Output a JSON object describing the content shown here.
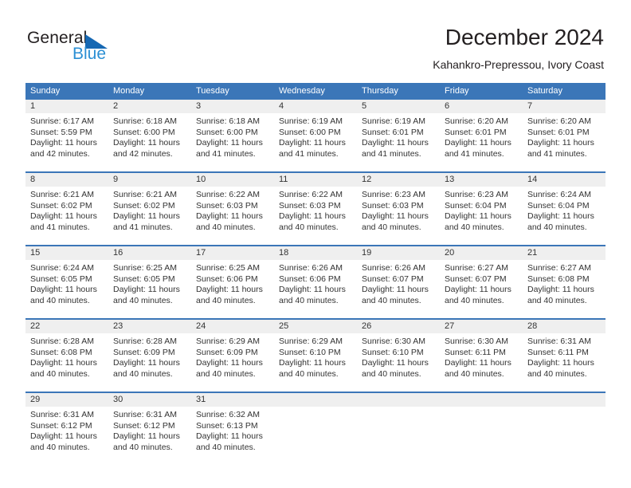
{
  "brand": {
    "word_one": "General",
    "word_two": "Blue",
    "triangle_icon": "triangle-icon",
    "accent_blue": "#1668b3",
    "light_blue": "#2b8fd4"
  },
  "header": {
    "title": "December 2024",
    "subtitle": "Kahankro-Prepressou, Ivory Coast"
  },
  "theme": {
    "header_blue": "#3b76b8",
    "day_band_gray": "#efefef",
    "text": "#333333"
  },
  "calendar": {
    "weekdays": [
      "Sunday",
      "Monday",
      "Tuesday",
      "Wednesday",
      "Thursday",
      "Friday",
      "Saturday"
    ],
    "weeks": [
      [
        {
          "day": "1",
          "sunrise": "Sunrise: 6:17 AM",
          "sunset": "Sunset: 5:59 PM",
          "daylight_1": "Daylight: 11 hours",
          "daylight_2": "and 42 minutes."
        },
        {
          "day": "2",
          "sunrise": "Sunrise: 6:18 AM",
          "sunset": "Sunset: 6:00 PM",
          "daylight_1": "Daylight: 11 hours",
          "daylight_2": "and 42 minutes."
        },
        {
          "day": "3",
          "sunrise": "Sunrise: 6:18 AM",
          "sunset": "Sunset: 6:00 PM",
          "daylight_1": "Daylight: 11 hours",
          "daylight_2": "and 41 minutes."
        },
        {
          "day": "4",
          "sunrise": "Sunrise: 6:19 AM",
          "sunset": "Sunset: 6:00 PM",
          "daylight_1": "Daylight: 11 hours",
          "daylight_2": "and 41 minutes."
        },
        {
          "day": "5",
          "sunrise": "Sunrise: 6:19 AM",
          "sunset": "Sunset: 6:01 PM",
          "daylight_1": "Daylight: 11 hours",
          "daylight_2": "and 41 minutes."
        },
        {
          "day": "6",
          "sunrise": "Sunrise: 6:20 AM",
          "sunset": "Sunset: 6:01 PM",
          "daylight_1": "Daylight: 11 hours",
          "daylight_2": "and 41 minutes."
        },
        {
          "day": "7",
          "sunrise": "Sunrise: 6:20 AM",
          "sunset": "Sunset: 6:01 PM",
          "daylight_1": "Daylight: 11 hours",
          "daylight_2": "and 41 minutes."
        }
      ],
      [
        {
          "day": "8",
          "sunrise": "Sunrise: 6:21 AM",
          "sunset": "Sunset: 6:02 PM",
          "daylight_1": "Daylight: 11 hours",
          "daylight_2": "and 41 minutes."
        },
        {
          "day": "9",
          "sunrise": "Sunrise: 6:21 AM",
          "sunset": "Sunset: 6:02 PM",
          "daylight_1": "Daylight: 11 hours",
          "daylight_2": "and 41 minutes."
        },
        {
          "day": "10",
          "sunrise": "Sunrise: 6:22 AM",
          "sunset": "Sunset: 6:03 PM",
          "daylight_1": "Daylight: 11 hours",
          "daylight_2": "and 40 minutes."
        },
        {
          "day": "11",
          "sunrise": "Sunrise: 6:22 AM",
          "sunset": "Sunset: 6:03 PM",
          "daylight_1": "Daylight: 11 hours",
          "daylight_2": "and 40 minutes."
        },
        {
          "day": "12",
          "sunrise": "Sunrise: 6:23 AM",
          "sunset": "Sunset: 6:03 PM",
          "daylight_1": "Daylight: 11 hours",
          "daylight_2": "and 40 minutes."
        },
        {
          "day": "13",
          "sunrise": "Sunrise: 6:23 AM",
          "sunset": "Sunset: 6:04 PM",
          "daylight_1": "Daylight: 11 hours",
          "daylight_2": "and 40 minutes."
        },
        {
          "day": "14",
          "sunrise": "Sunrise: 6:24 AM",
          "sunset": "Sunset: 6:04 PM",
          "daylight_1": "Daylight: 11 hours",
          "daylight_2": "and 40 minutes."
        }
      ],
      [
        {
          "day": "15",
          "sunrise": "Sunrise: 6:24 AM",
          "sunset": "Sunset: 6:05 PM",
          "daylight_1": "Daylight: 11 hours",
          "daylight_2": "and 40 minutes."
        },
        {
          "day": "16",
          "sunrise": "Sunrise: 6:25 AM",
          "sunset": "Sunset: 6:05 PM",
          "daylight_1": "Daylight: 11 hours",
          "daylight_2": "and 40 minutes."
        },
        {
          "day": "17",
          "sunrise": "Sunrise: 6:25 AM",
          "sunset": "Sunset: 6:06 PM",
          "daylight_1": "Daylight: 11 hours",
          "daylight_2": "and 40 minutes."
        },
        {
          "day": "18",
          "sunrise": "Sunrise: 6:26 AM",
          "sunset": "Sunset: 6:06 PM",
          "daylight_1": "Daylight: 11 hours",
          "daylight_2": "and 40 minutes."
        },
        {
          "day": "19",
          "sunrise": "Sunrise: 6:26 AM",
          "sunset": "Sunset: 6:07 PM",
          "daylight_1": "Daylight: 11 hours",
          "daylight_2": "and 40 minutes."
        },
        {
          "day": "20",
          "sunrise": "Sunrise: 6:27 AM",
          "sunset": "Sunset: 6:07 PM",
          "daylight_1": "Daylight: 11 hours",
          "daylight_2": "and 40 minutes."
        },
        {
          "day": "21",
          "sunrise": "Sunrise: 6:27 AM",
          "sunset": "Sunset: 6:08 PM",
          "daylight_1": "Daylight: 11 hours",
          "daylight_2": "and 40 minutes."
        }
      ],
      [
        {
          "day": "22",
          "sunrise": "Sunrise: 6:28 AM",
          "sunset": "Sunset: 6:08 PM",
          "daylight_1": "Daylight: 11 hours",
          "daylight_2": "and 40 minutes."
        },
        {
          "day": "23",
          "sunrise": "Sunrise: 6:28 AM",
          "sunset": "Sunset: 6:09 PM",
          "daylight_1": "Daylight: 11 hours",
          "daylight_2": "and 40 minutes."
        },
        {
          "day": "24",
          "sunrise": "Sunrise: 6:29 AM",
          "sunset": "Sunset: 6:09 PM",
          "daylight_1": "Daylight: 11 hours",
          "daylight_2": "and 40 minutes."
        },
        {
          "day": "25",
          "sunrise": "Sunrise: 6:29 AM",
          "sunset": "Sunset: 6:10 PM",
          "daylight_1": "Daylight: 11 hours",
          "daylight_2": "and 40 minutes."
        },
        {
          "day": "26",
          "sunrise": "Sunrise: 6:30 AM",
          "sunset": "Sunset: 6:10 PM",
          "daylight_1": "Daylight: 11 hours",
          "daylight_2": "and 40 minutes."
        },
        {
          "day": "27",
          "sunrise": "Sunrise: 6:30 AM",
          "sunset": "Sunset: 6:11 PM",
          "daylight_1": "Daylight: 11 hours",
          "daylight_2": "and 40 minutes."
        },
        {
          "day": "28",
          "sunrise": "Sunrise: 6:31 AM",
          "sunset": "Sunset: 6:11 PM",
          "daylight_1": "Daylight: 11 hours",
          "daylight_2": "and 40 minutes."
        }
      ],
      [
        {
          "day": "29",
          "sunrise": "Sunrise: 6:31 AM",
          "sunset": "Sunset: 6:12 PM",
          "daylight_1": "Daylight: 11 hours",
          "daylight_2": "and 40 minutes."
        },
        {
          "day": "30",
          "sunrise": "Sunrise: 6:31 AM",
          "sunset": "Sunset: 6:12 PM",
          "daylight_1": "Daylight: 11 hours",
          "daylight_2": "and 40 minutes."
        },
        {
          "day": "31",
          "sunrise": "Sunrise: 6:32 AM",
          "sunset": "Sunset: 6:13 PM",
          "daylight_1": "Daylight: 11 hours",
          "daylight_2": "and 40 minutes."
        },
        {
          "day": "",
          "sunrise": "",
          "sunset": "",
          "daylight_1": "",
          "daylight_2": ""
        },
        {
          "day": "",
          "sunrise": "",
          "sunset": "",
          "daylight_1": "",
          "daylight_2": ""
        },
        {
          "day": "",
          "sunrise": "",
          "sunset": "",
          "daylight_1": "",
          "daylight_2": ""
        },
        {
          "day": "",
          "sunrise": "",
          "sunset": "",
          "daylight_1": "",
          "daylight_2": ""
        }
      ]
    ]
  }
}
